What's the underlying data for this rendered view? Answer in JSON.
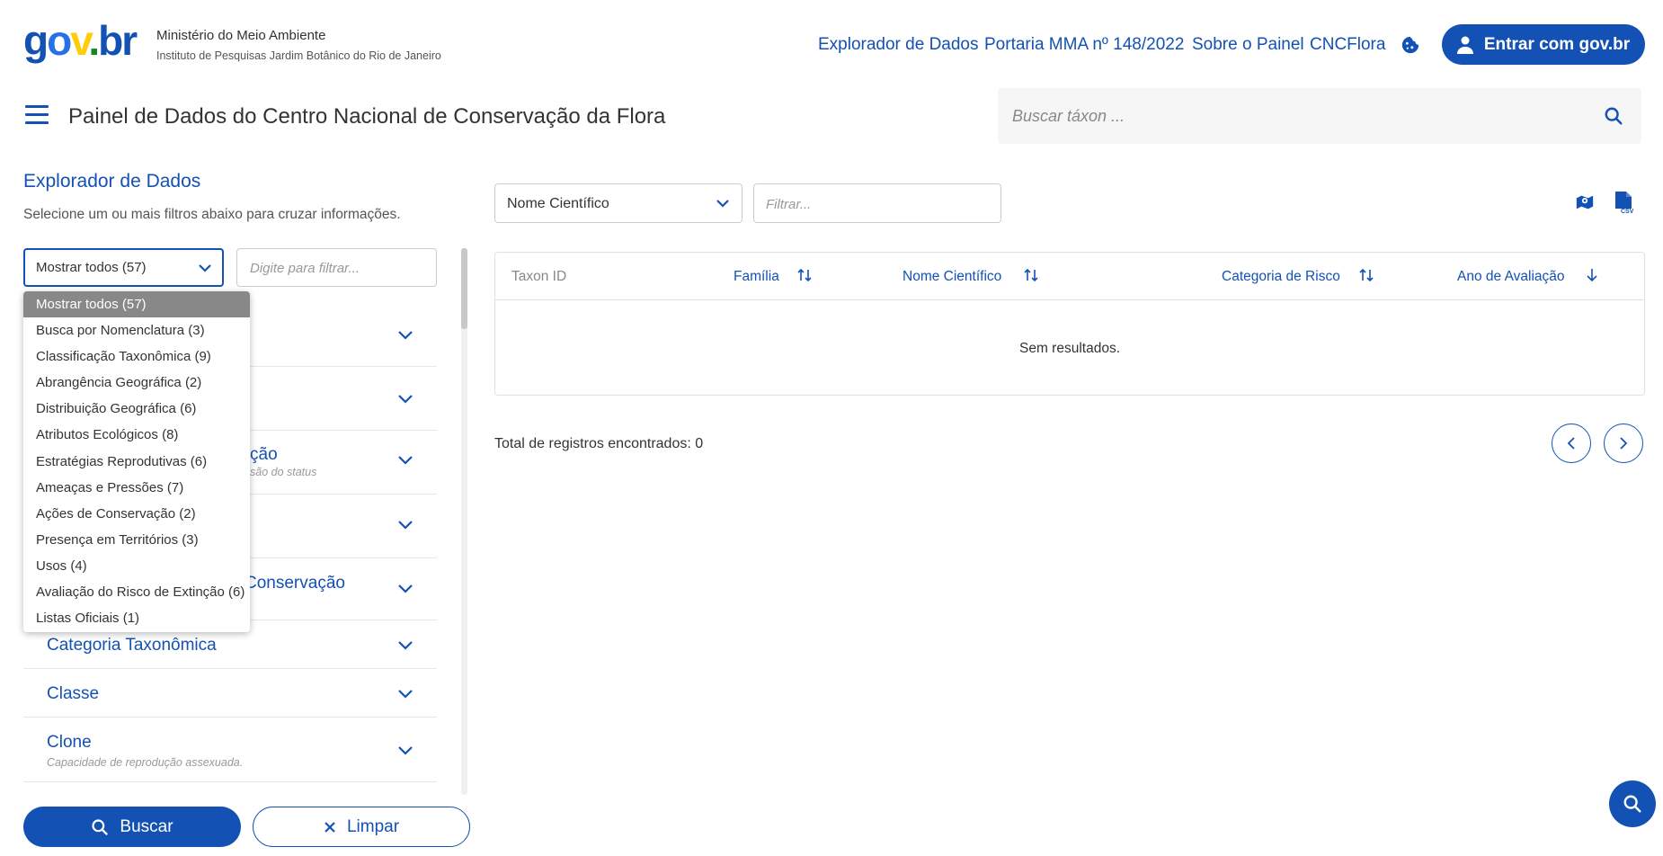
{
  "colors": {
    "primary": "#1351b4",
    "dropdown_selected_bg": "#888888",
    "logo_yellow": "#ffcd07",
    "logo_green": "#168821"
  },
  "header": {
    "logo": "gov.br",
    "org_line1": "Ministério do Meio Ambiente",
    "org_line2": "Instituto de Pesquisas Jardim Botânico do Rio de Janeiro",
    "links": [
      "Explorador de Dados",
      "Portaria MMA nº 148/2022",
      "Sobre o Painel",
      "CNCFlora"
    ],
    "cookie_icon": "cookie-icon",
    "login_label": "Entrar com gov.br"
  },
  "titlebar": {
    "title": "Painel de Dados do Centro Nacional de Conservação da Flora",
    "search_placeholder": "Buscar táxon ..."
  },
  "explorer": {
    "title": "Explorador de Dados",
    "subtitle": "Selecione um ou mais filtros abaixo para cruzar informações.",
    "group_select_value": "Mostrar todos (57)",
    "filter_placeholder": "Digite para filtrar...",
    "dropdown_options": [
      "Mostrar todos (57)",
      "Busca por Nomenclatura (3)",
      "Classificação Taxonômica (9)",
      "Abrangência Geográfica (2)",
      "Distribuição Geográfica (6)",
      "Atributos Ecológicos (8)",
      "Estratégias Reprodutivas (6)",
      "Ameaças e Pressões (7)",
      "Ações de Conservação (2)",
      "Presença em Territórios (3)",
      "Usos (4)",
      "Avaliação do Risco de Extinção (6)",
      "Listas Oficiais (1)"
    ],
    "accordion_partial": [
      {
        "label": "ção",
        "sub": "são do status"
      },
      {
        "label": "Conservação"
      }
    ],
    "accordion_items": [
      {
        "label": "Categoria Taxonômica",
        "sub": ""
      },
      {
        "label": "Classe",
        "sub": ""
      },
      {
        "label": "Clone",
        "sub": "Capacidade de reprodução assexuada."
      }
    ],
    "search_button": "Buscar",
    "clear_button": "Limpar"
  },
  "results": {
    "column_select_value": "Nome Científico",
    "filter_placeholder": "Filtrar...",
    "columns": [
      "Taxon ID",
      "Família",
      "Nome Científico",
      "Categoria de Risco",
      "Ano de Avaliação"
    ],
    "empty_text": "Sem resultados.",
    "total_text": "Total de registros encontrados: 0"
  }
}
